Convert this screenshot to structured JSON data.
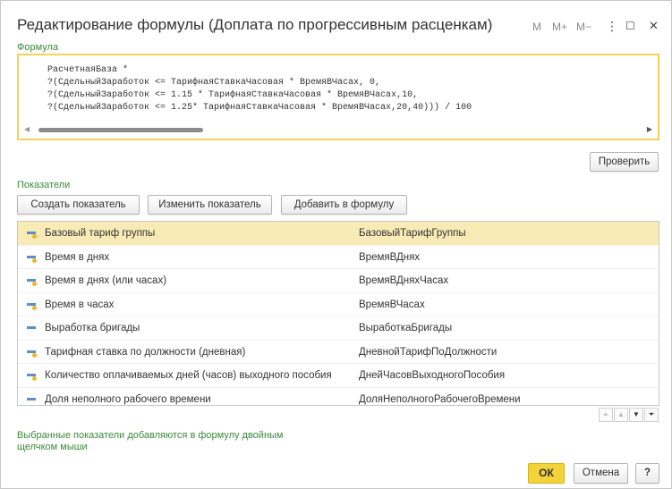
{
  "window": {
    "title": "Редактирование формулы (Доплата по прогрессивным расценкам)",
    "controls": {
      "m": "M",
      "m_plus": "M+",
      "m_minus": "M−",
      "more": "⋮",
      "maximize": "☐",
      "close": "✕"
    }
  },
  "formula": {
    "label": "Формула",
    "lines": [
      "РасчетнаяБаза *",
      "?(СдельныйЗаработок <= ТарифнаяСтавкаЧасовая * ВремяВЧасах, 0,",
      "?(СдельныйЗаработок <= 1.15 * ТарифнаяСтавкаЧасовая * ВремяВЧасах,10,",
      "?(СдельныйЗаработок <= 1.25* ТарифнаяСтавкаЧасовая * ВремяВЧасах,20,40))) / 100"
    ],
    "check_label": "Проверить"
  },
  "indicators": {
    "label": "Показатели",
    "buttons": {
      "create": "Создать показатель",
      "edit": "Изменить показатель",
      "add": "Добавить в формулу"
    },
    "rows": [
      {
        "name": "Базовый тариф группы",
        "code": "БазовыйТарифГруппы",
        "selected": true,
        "icon": "indicator-icon-yellow"
      },
      {
        "name": "Время в днях",
        "code": "ВремяВДнях",
        "selected": false,
        "icon": "indicator-icon-yellow"
      },
      {
        "name": "Время в днях (или часах)",
        "code": "ВремяВДняхЧасах",
        "selected": false,
        "icon": "indicator-icon-yellow"
      },
      {
        "name": "Время в часах",
        "code": "ВремяВЧасах",
        "selected": false,
        "icon": "indicator-icon-yellow"
      },
      {
        "name": "Выработка бригады",
        "code": "ВыработкаБригады",
        "selected": false,
        "icon": "indicator-icon-blue"
      },
      {
        "name": "Тарифная ставка по должности (дневная)",
        "code": "ДневнойТарифПоДолжности",
        "selected": false,
        "icon": "indicator-icon-yellow"
      },
      {
        "name": "Количество оплачиваемых дней (часов) выходного пособия",
        "code": "ДнейЧасовВыходногоПособия",
        "selected": false,
        "icon": "indicator-icon-yellow"
      },
      {
        "name": "Доля неполного рабочего времени",
        "code": "ДоляНеполногоРабочегоВремени",
        "selected": false,
        "icon": "indicator-icon-blue"
      }
    ],
    "nav": {
      "first": "⏶",
      "up": "▲",
      "down": "▼",
      "last": "⏷"
    }
  },
  "hint": "Выбранные показатели добавляются в формулу двойным щелчком мыши",
  "footer": {
    "ok": "ОК",
    "cancel": "Отмена",
    "help": "?"
  },
  "colors": {
    "accent": "#f4d23a",
    "selection": "#f8ebb6",
    "label_green": "#3a8a3a"
  }
}
